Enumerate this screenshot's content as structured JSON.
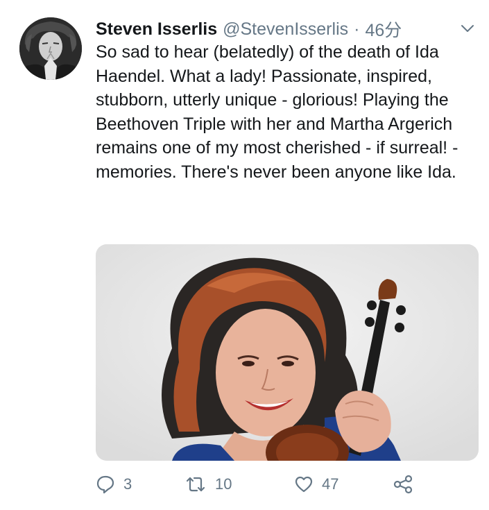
{
  "tweet": {
    "author_name": "Steven Isserlis",
    "handle": "@StevenIsserlis",
    "separator": "·",
    "time": "46分",
    "text": "So sad to hear (belatedly) of the death of Ida Haendel. What a lady! Passionate, inspired, stubborn, utterly unique - glorious! Playing the Beethoven Triple with her and Martha Argerich remains one of my most cherished - if surreal! - memories. There's never been anyone like Ida.",
    "actions": {
      "reply_count": "3",
      "retweet_count": "10",
      "like_count": "47"
    }
  },
  "icons": {
    "reply": "reply-icon",
    "retweet": "retweet-icon",
    "like": "heart-icon",
    "share": "share-icon",
    "more": "chevron-down-icon"
  },
  "colors": {
    "text": "#14171a",
    "secondary": "#657786"
  }
}
